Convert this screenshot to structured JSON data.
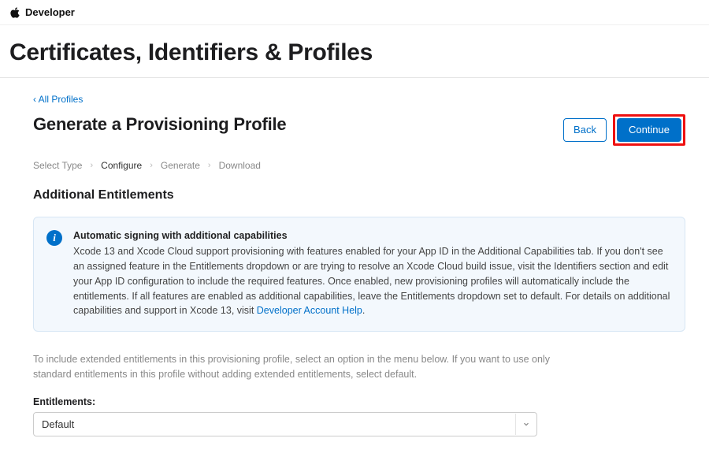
{
  "nav": {
    "brand": "Developer"
  },
  "page": {
    "title": "Certificates, Identifiers & Profiles",
    "back_link": "‹ All Profiles",
    "subtitle": "Generate a Provisioning Profile"
  },
  "buttons": {
    "back": "Back",
    "continue": "Continue"
  },
  "steps": {
    "s1": "Select Type",
    "s2": "Configure",
    "s3": "Generate",
    "s4": "Download"
  },
  "section_title": "Additional Entitlements",
  "info": {
    "title": "Automatic signing with additional capabilities",
    "body_part1": "Xcode 13 and Xcode Cloud support provisioning with features enabled for your App ID in the Additional Capabilities tab. If you don't see an assigned feature in the Entitlements dropdown or are trying to resolve an Xcode Cloud build issue, visit the Identifiers section and edit your App ID configuration to include the required features. Once enabled, new provisioning profiles will automatically include the entitlements. If all features are enabled as additional capabilities, leave the Entitlements dropdown set to default. For details on additional capabilities and support in Xcode 13, visit ",
    "link": "Developer Account Help",
    "body_part2": "."
  },
  "helper": "To include extended entitlements in this provisioning profile, select an option in the menu below. If you want to use only standard entitlements in this profile without adding extended entitlements, select default.",
  "field": {
    "label": "Entitlements:",
    "value": "Default"
  }
}
